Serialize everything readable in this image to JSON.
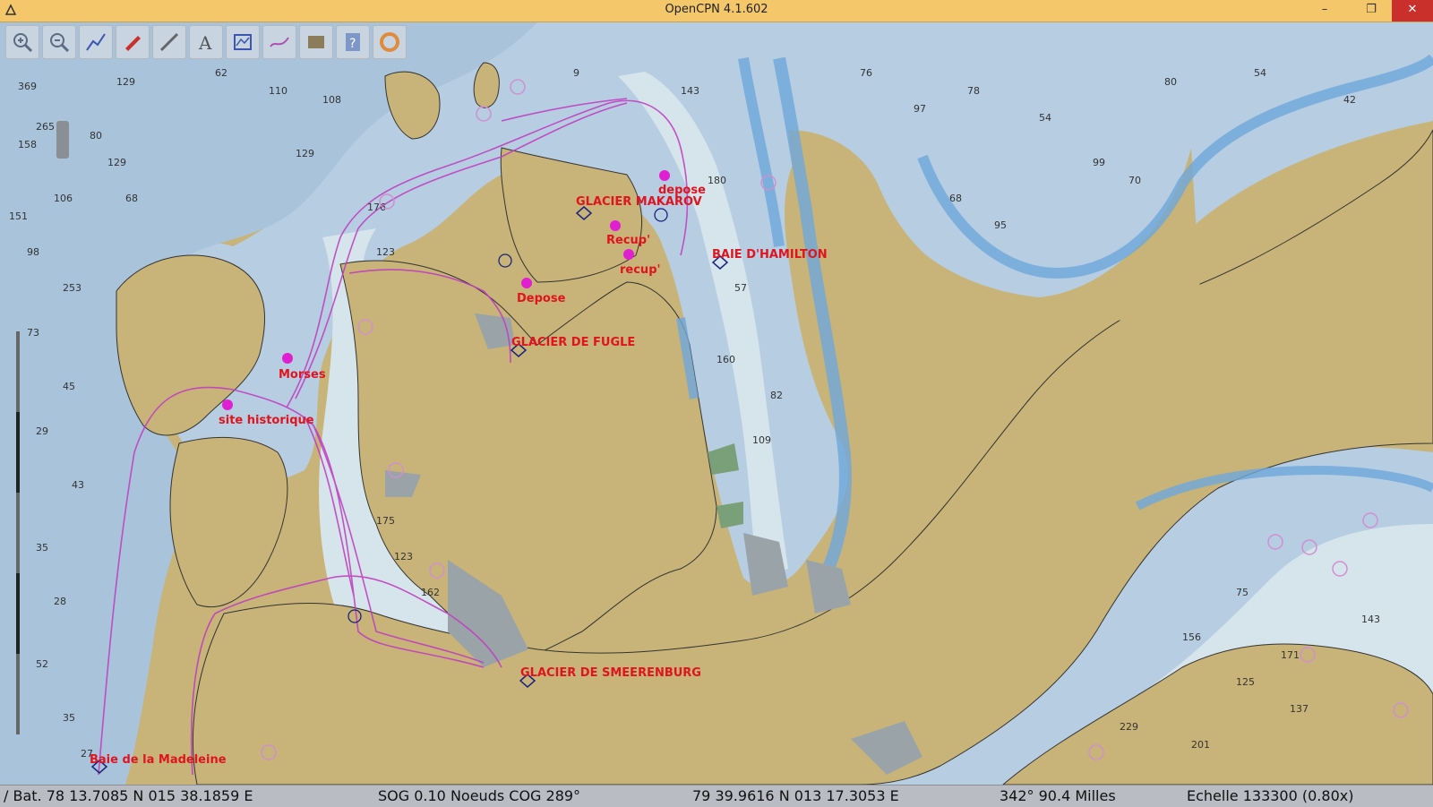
{
  "window": {
    "title": "OpenCPN 4.1.602",
    "minimize": "–",
    "restore": "❐",
    "close": "✕"
  },
  "toolbar": {
    "buttons": [
      {
        "name": "zoom-in",
        "icon": "zoom-in-icon"
      },
      {
        "name": "zoom-out",
        "icon": "zoom-out-icon"
      },
      {
        "name": "route",
        "icon": "route-icon"
      },
      {
        "name": "ship",
        "icon": "ship-icon"
      },
      {
        "name": "measure",
        "icon": "measure-icon"
      },
      {
        "name": "text",
        "icon": "text-icon"
      },
      {
        "name": "tide",
        "icon": "tide-icon"
      },
      {
        "name": "track",
        "icon": "track-icon"
      },
      {
        "name": "chart-info",
        "icon": "chart-icon"
      },
      {
        "name": "help",
        "icon": "help-icon"
      },
      {
        "name": "settings",
        "icon": "lifebuoy-icon"
      }
    ]
  },
  "map": {
    "labels": {
      "glacier_makarov": "GLACIER MAKAROV",
      "glacier_fugle": "GLACIER DE FUGLE",
      "glacier_smeerenburg": "GLACIER DE SMEERENBURG",
      "baie_hamilton": "BAIE D'HAMILTON",
      "baie_madeleine": "Baie de la Madeleine",
      "depose1": "depose",
      "depose2": "Depose",
      "recup1": "Recup'",
      "recup2": "recup'",
      "morses": "Morses",
      "site": "site historique"
    },
    "colors": {
      "land": "#c8b478",
      "shallow": "#6fa8dc",
      "water_light": "#d6e4ec",
      "water_mid": "#b9d1e4",
      "water_deep": "#a9c3db",
      "route": "#c040c0",
      "label": "#e0141e"
    }
  },
  "status": {
    "bat": "/ Bat. 78 13.7085 N   015 38.1859 E",
    "sog": "SOG 0.10 Noeuds  COG 289°",
    "cursor": "79 39.9616 N   013 17.3053 E",
    "bearing": "342°  90.4 Milles",
    "scale": "Echelle 133300 (0.80x)"
  }
}
